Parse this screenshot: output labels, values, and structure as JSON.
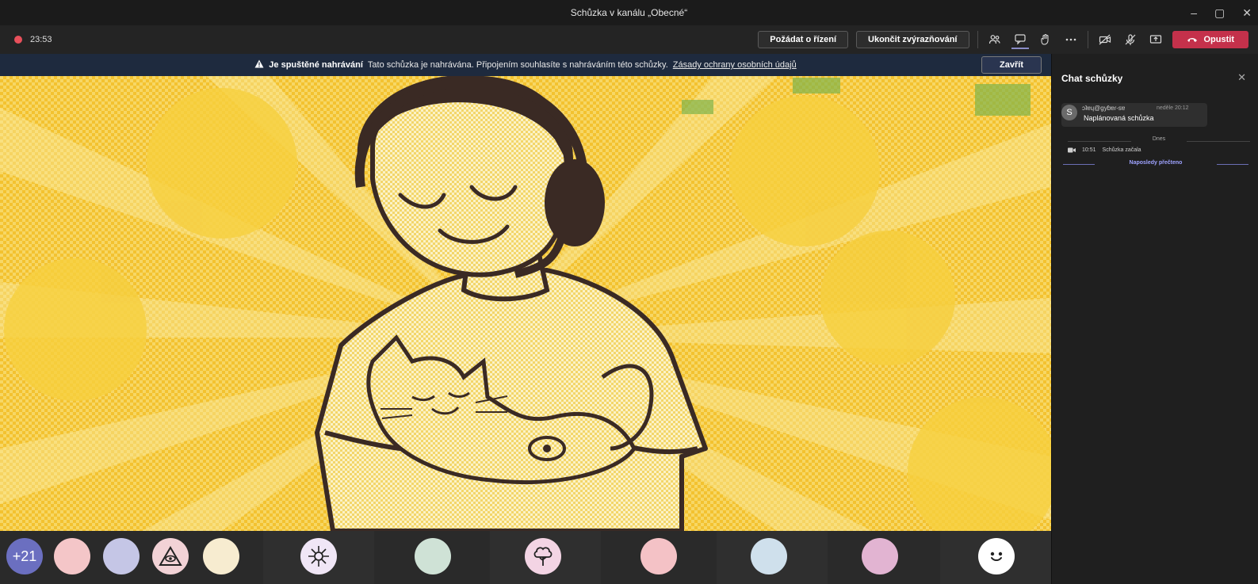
{
  "window": {
    "title": "Schůzka v kanálu „Obecné“",
    "controls": [
      "–",
      "▢",
      "✕"
    ]
  },
  "toolbar": {
    "timer": "23:53",
    "request_control": "Požádat o řízení",
    "end_highlight": "Ukončit zvýrazňování",
    "leave": "Opustit"
  },
  "banner": {
    "title": "Je spuštěné nahrávání",
    "text": "Tato schůzka je nahrávána. Připojením souhlasíte s nahráváním této schůzky.",
    "link": "Zásady ochrany osobních údajů",
    "close": "Zavřít"
  },
  "chat": {
    "title": "Chat schůzky",
    "message": {
      "sender": "ɔʇɐɥ@gyɓɐɾ-sɐ",
      "time": "neděle 20:12",
      "text": "Naplánovaná schůzka"
    },
    "day_label": "Dnes",
    "event": {
      "time": "10:51",
      "text": "Schůzka začala"
    },
    "last_read": "Naposledy přečteno"
  },
  "participants": {
    "overflow_count": "+21",
    "colors": {
      "p1": "#f4c6c8",
      "p2": "#c5c6e6",
      "p3": "#f2d2d6",
      "p4": "#f7ecd0",
      "p5": "#f0e6f6",
      "p6": "#cfe2d6",
      "p7": "#f3d4e4",
      "p8": "#f4c2c6",
      "p9": "#cfe0ec",
      "p10": "#e2b4d2",
      "p11": "#ffffff"
    }
  }
}
